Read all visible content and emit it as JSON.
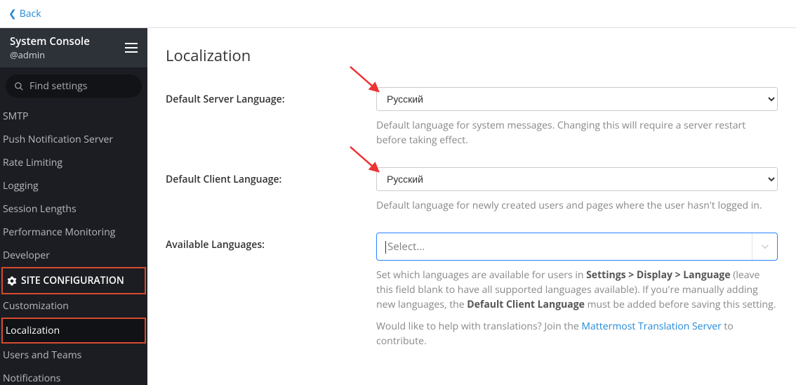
{
  "back_link": {
    "label": "Back"
  },
  "sidebar": {
    "title": "System Console",
    "subtitle": "@admin",
    "search_placeholder": "Find settings",
    "items": [
      {
        "label": "SMTP"
      },
      {
        "label": "Push Notification Server"
      },
      {
        "label": "Rate Limiting"
      },
      {
        "label": "Logging"
      },
      {
        "label": "Session Lengths"
      },
      {
        "label": "Performance Monitoring"
      },
      {
        "label": "Developer"
      }
    ],
    "section_head": "SITE CONFIGURATION",
    "section_items": [
      {
        "label": "Customization"
      },
      {
        "label": "Localization",
        "active": true
      },
      {
        "label": "Users and Teams"
      },
      {
        "label": "Notifications"
      }
    ]
  },
  "page": {
    "title": "Localization",
    "server_lang": {
      "label": "Default Server Language:",
      "value": "Русский",
      "help": "Default language for system messages. Changing this will require a server restart before taking effect."
    },
    "client_lang": {
      "label": "Default Client Language:",
      "value": "Русский",
      "help": "Default language for newly created users and pages where the user hasn't logged in."
    },
    "available": {
      "label": "Available Languages:",
      "placeholder": "Select...",
      "help_pre": "Set which languages are available for users in ",
      "help_path": "Settings > Display > Language",
      "help_mid": " (leave this field blank to have all supported languages available). If you're manually adding new languages, the ",
      "help_strong": "Default Client Language",
      "help_post": " must be added before saving this setting.",
      "help2_pre": "Would like to help with translations? Join the ",
      "help2_link": "Mattermost Translation Server",
      "help2_post": " to contribute."
    }
  }
}
